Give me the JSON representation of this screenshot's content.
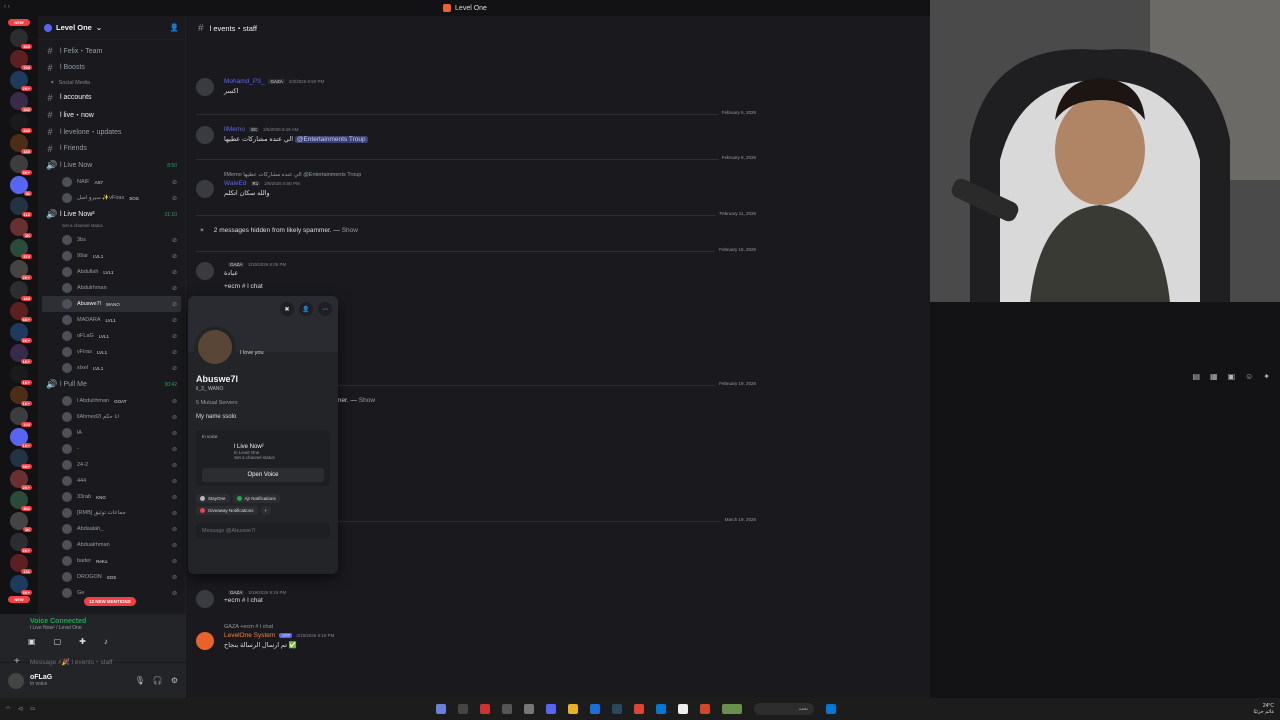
{
  "app": {
    "title": "Level One"
  },
  "guild": {
    "name": "Level One"
  },
  "channel": {
    "name": "l events・staff"
  },
  "server_rail": {
    "new_label": "NEW",
    "badges": [
      "303",
      "704",
      "2K+",
      "442",
      "240",
      "160",
      "3K+",
      "91",
      "112",
      "1K",
      "374",
      "2K+",
      "163",
      "6K+",
      "2K+",
      "1K+",
      "1K+",
      "1K+",
      "104",
      "1K+",
      "3K+",
      "2K+",
      "301",
      "1K",
      "2K+",
      "131",
      "3K+"
    ]
  },
  "sidebar": {
    "channels": [
      {
        "name": "l Felix・Team"
      },
      {
        "name": "l Boosts"
      }
    ],
    "category_social": "Social Media",
    "social_channels": [
      {
        "name": "l accounts"
      },
      {
        "name": "l live・now"
      },
      {
        "name": "l levelone・updates"
      },
      {
        "name": "l Friends"
      }
    ],
    "voice1": {
      "name": "l Live Now",
      "time": "8:50"
    },
    "voice1_users": [
      {
        "name": "NAIF",
        "tag": "AS7"
      },
      {
        "name": "سیرو اصل ✨vFiras",
        "tag": "SOS"
      }
    ],
    "voice2": {
      "name": "l Live Now²",
      "time": "31:10",
      "status": "Set a channel status"
    },
    "voice2_users": [
      {
        "name": "3bs",
        "tag": ""
      },
      {
        "name": "99ar",
        "tag": "LVL1"
      },
      {
        "name": "Abdullah",
        "tag": "LVL1"
      },
      {
        "name": "Abdulrhman",
        "tag": ""
      },
      {
        "name": "Abuswe7l",
        "tag": "WANO"
      },
      {
        "name": "MADARA",
        "tag": "LVL1"
      },
      {
        "name": "oFLaG",
        "tag": "LVL1"
      },
      {
        "name": "vFiras",
        "tag": "LVL1"
      },
      {
        "name": "xlxel",
        "tag": "LVL1"
      }
    ],
    "voice3": {
      "name": "l Pull Me",
      "time": "30:42"
    },
    "voice3_users": [
      {
        "name": "l Abdulrhman",
        "tag": "GOAT"
      },
      {
        "name": "llAhmed2l انا حكم",
        "tag": ""
      },
      {
        "name": "lA",
        "tag": ""
      },
      {
        "name": "-",
        "tag": ""
      },
      {
        "name": "24-2",
        "tag": ""
      },
      {
        "name": "444",
        "tag": ""
      },
      {
        "name": "33rab",
        "tag": "KNG"
      },
      {
        "name": "[RMB] جماعات توثيق",
        "tag": ""
      },
      {
        "name": "Abdaalah_",
        "tag": ""
      },
      {
        "name": "Abdualrhman",
        "tag": ""
      },
      {
        "name": "bader",
        "tag": "ReKo"
      },
      {
        "name": "DROGON",
        "tag": "SOS"
      },
      {
        "name": "Ge",
        "tag": ""
      }
    ],
    "mentions_label": "12 NEW MENTIONS"
  },
  "voice_panel": {
    "title": "Voice Connected",
    "subtitle": "l Live Now² / Level One"
  },
  "user": {
    "name": "oFLaG",
    "status": "In voice"
  },
  "messages": [
    {
      "author": "Mohamd_P3_",
      "tag": "GAZA",
      "time": "2/3/2026 8:50 PM",
      "body": "اكسر"
    },
    {
      "author": "llMemo",
      "tag": "SC",
      "time": "2/5/2026 6:15 AM",
      "body": "الي عنده مشاركات عطيها",
      "mention": "@Entertainments Troup"
    },
    {
      "author": "WaleEd",
      "tag": "R1",
      "time": "2/9/2026 8:50 PM",
      "body": "والله سكان اتكلم",
      "reply": "llMemo الي عنده مشاركات عطيها @Entertainments Troup"
    },
    {
      "author": "",
      "tag": "GAZA",
      "time": "2/15/2026 8:05 PM",
      "body": "عبادة",
      "extra": "+ecm # l chat"
    },
    {
      "author": "",
      "tag": "GAZA",
      "time": "3/19/2026 9:19 PM",
      "body": "+ecm # l chat"
    },
    {
      "author": "LevelOne System",
      "tag": "APP",
      "time": "3/19/2026 9:19 PM",
      "body": "تم ارسال الرسالة بنجاح ✅",
      "reply": "GAZA +ecm # l chat"
    }
  ],
  "date_dividers": [
    "February 5, 2026",
    "February 9, 2026",
    "February 11, 2026",
    "February 15, 2026",
    "February 19, 2026",
    "March 19, 2026"
  ],
  "hidden_messages": {
    "text": "2 messages hidden from likely spammer. —",
    "show": "Show"
  },
  "hidden_messages_2": {
    "text": "mer. —",
    "show": "Show"
  },
  "profile": {
    "name": "Abuswe7l",
    "handle": "il_3_",
    "tag": "WANO",
    "bubble": "I love you",
    "mutual": "5 Mutual Servers",
    "about": "My name ssolo",
    "voice_label": "In voice",
    "voice_channel": "l Live Now²",
    "voice_server": "in Level One",
    "voice_status": "Set a channel status",
    "open_voice": "Open Voice",
    "roles": [
      {
        "name": "StayOne",
        "color": "#b5bac1"
      },
      {
        "name": "Ajr Notifications",
        "color": "#23a55a"
      },
      {
        "name": "Giveaway Notifications",
        "color": "#f23f43"
      }
    ],
    "message_placeholder": "Message @Abuswe7l"
  },
  "composer": {
    "placeholder": "Message #🎉 l events・staff"
  },
  "taskbar": {
    "search": "بحث",
    "temp": "24°C",
    "weather": "غائم جزئيًا",
    "time": "١١:٠٣ م",
    "date": "٢٠٢٦/٠٣/١٩"
  }
}
